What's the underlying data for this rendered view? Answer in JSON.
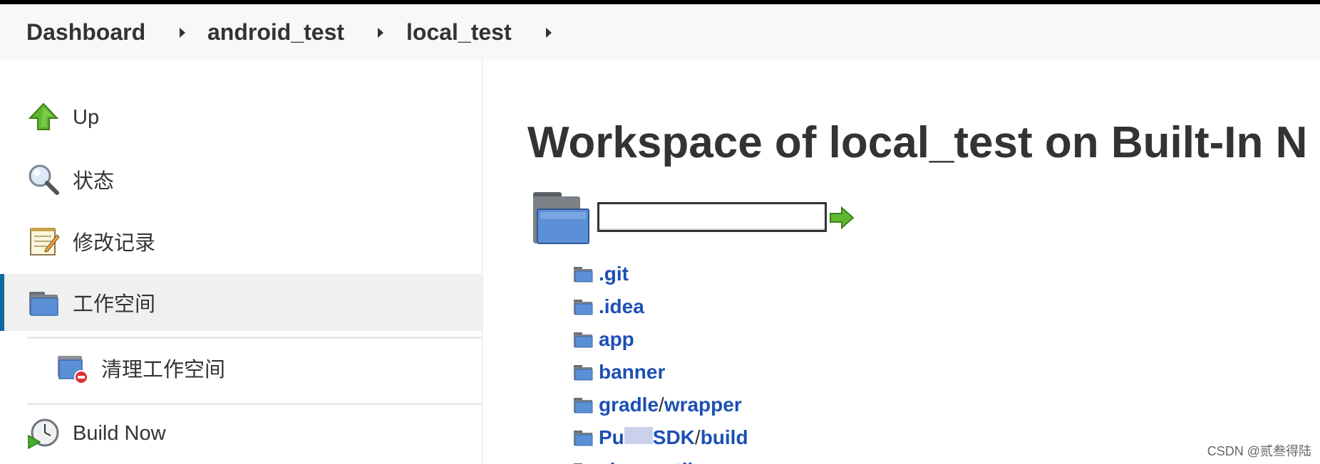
{
  "breadcrumb": {
    "items": [
      {
        "label": "Dashboard"
      },
      {
        "label": "android_test"
      },
      {
        "label": "local_test"
      }
    ]
  },
  "sidebar": {
    "items": [
      {
        "label": "Up",
        "icon": "up-arrow-icon"
      },
      {
        "label": "状态",
        "icon": "magnifier-icon"
      },
      {
        "label": "修改记录",
        "icon": "notepad-icon"
      },
      {
        "label": "工作空间",
        "icon": "folder-icon",
        "active": true
      },
      {
        "label": "清理工作空间",
        "icon": "folder-delete-icon",
        "sub": true
      },
      {
        "label": "Build Now",
        "icon": "clock-play-icon"
      }
    ]
  },
  "main": {
    "title": "Workspace of local_test on Built-In N",
    "path_input_value": "",
    "files": [
      {
        "parts": [
          ".git"
        ]
      },
      {
        "parts": [
          ".idea"
        ]
      },
      {
        "parts": [
          "app"
        ]
      },
      {
        "parts": [
          "banner"
        ]
      },
      {
        "parts": [
          "gradle",
          "wrapper"
        ]
      },
      {
        "parts": [
          "Pu",
          "SDK",
          "build"
        ]
      },
      {
        "parts": [
          "sharexutil"
        ]
      }
    ]
  },
  "watermark": "CSDN @贰叁得陆",
  "colors": {
    "link": "#1c4fb6",
    "active_bar": "#0b6aa2",
    "breadcrumb_bg": "#f8f8f8"
  }
}
